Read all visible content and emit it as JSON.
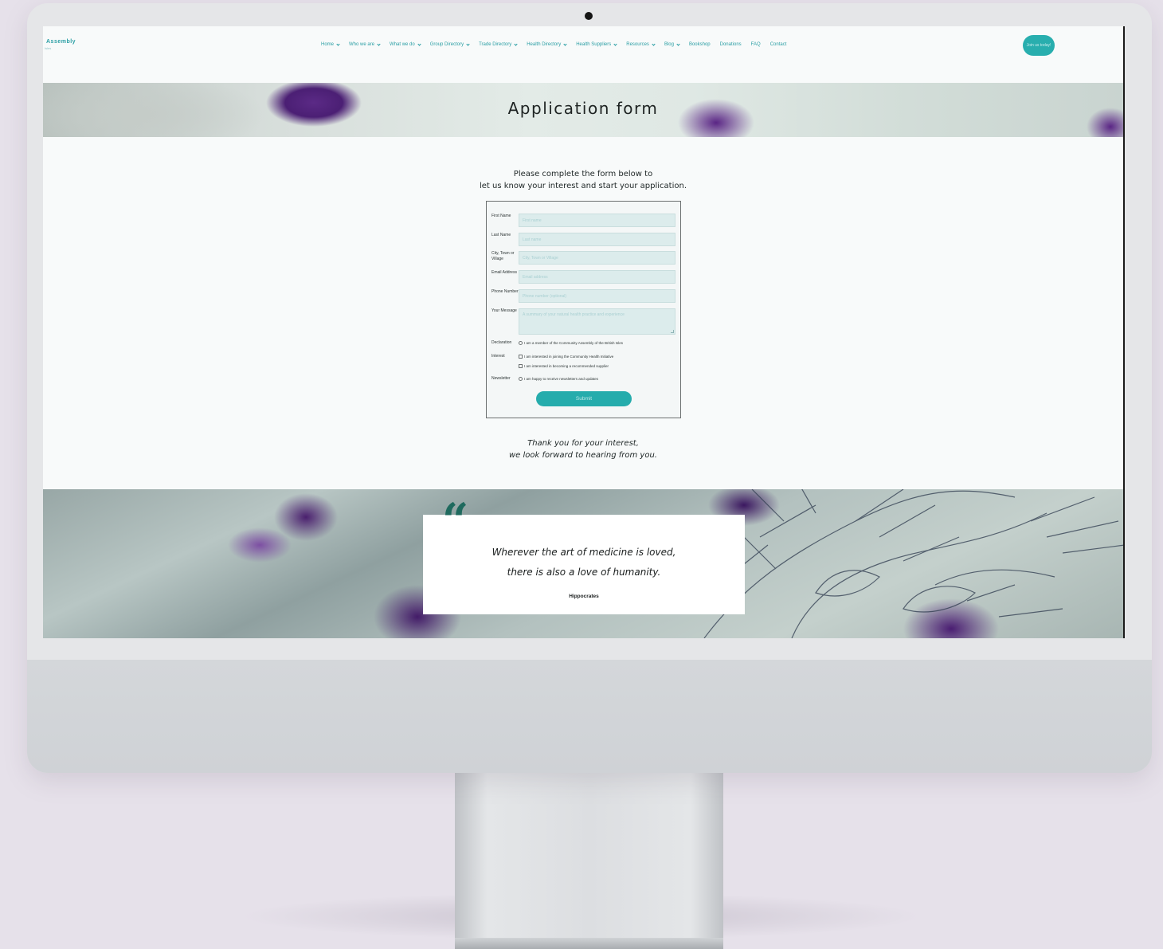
{
  "header": {
    "logo_name": "Assembly",
    "logo_sub": "Isles",
    "nav": [
      {
        "label": "Home",
        "dropdown": true
      },
      {
        "label": "Who we are",
        "dropdown": true
      },
      {
        "label": "What we do",
        "dropdown": true
      },
      {
        "label": "Group Directory",
        "dropdown": true
      },
      {
        "label": "Trade Directory",
        "dropdown": true
      },
      {
        "label": "Health Directory",
        "dropdown": true
      },
      {
        "label": "Health Suppliers",
        "dropdown": true
      },
      {
        "label": "Resources",
        "dropdown": true
      },
      {
        "label": "Blog",
        "dropdown": true
      },
      {
        "label": "Bookshop",
        "dropdown": false
      },
      {
        "label": "Donations",
        "dropdown": false
      },
      {
        "label": "FAQ",
        "dropdown": false
      },
      {
        "label": "Contact",
        "dropdown": false
      }
    ],
    "join_button": "Join us today!"
  },
  "hero": {
    "title": "Application form"
  },
  "intro": {
    "line1": "Please complete the form below to",
    "line2": "let us know your interest and start your application."
  },
  "form": {
    "fields": [
      {
        "label": "First Name",
        "placeholder": "First name",
        "value": ""
      },
      {
        "label": "Last Name",
        "placeholder": "Last name",
        "value": ""
      },
      {
        "label": "City, Town or Village",
        "placeholder": "City, Town or Village",
        "value": ""
      },
      {
        "label": "Email Address",
        "placeholder": "Email address",
        "value": ""
      },
      {
        "label": "Phone Number",
        "placeholder": "Phone number (optional)",
        "value": ""
      },
      {
        "label": "Your Message",
        "placeholder": "A summary of your natural health practice and experience",
        "value": ""
      }
    ],
    "declaration_label": "Declaration",
    "declaration_option": "I am a member of the Community Assembly of the British Isles",
    "interest_label": "Interest",
    "interest_options": [
      "I am interested in joining the Community Health Initiative",
      "I am interested in becoming a recommended supplier"
    ],
    "newsletter_label": "Newsletter",
    "newsletter_option": "I am happy to receive newsletters and updates",
    "submit_label": "Submit"
  },
  "thanks": {
    "line1": "Thank you for your interest,",
    "line2": "we look forward to hearing from you."
  },
  "quote": {
    "mark": "“",
    "line1": "Wherever the art of medicine is loved,",
    "line2": "there is also a love of humanity.",
    "author": "Hippocrates"
  },
  "colors": {
    "accent": "#28aeae",
    "nav_text": "#2a9ea4",
    "quote_mark": "#1f6a5e",
    "banner_purple": "#5b2a86"
  }
}
